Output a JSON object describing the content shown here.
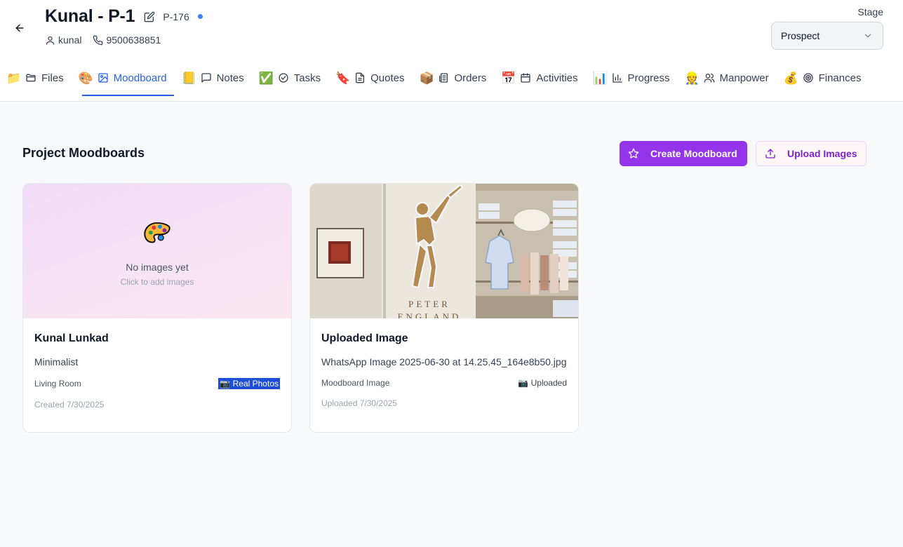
{
  "header": {
    "title": "Kunal - P-1",
    "code": "P-176",
    "user": "kunal",
    "phone": "9500638851",
    "stage_label": "Stage",
    "stage_value": "Prospect"
  },
  "tabs": [
    {
      "emoji": "📁",
      "label": "Files"
    },
    {
      "emoji": "🎨",
      "label": "Moodboard"
    },
    {
      "emoji": "📒",
      "label": "Notes"
    },
    {
      "emoji": "✅",
      "label": "Tasks"
    },
    {
      "emoji": "🔖",
      "label": "Quotes"
    },
    {
      "emoji": "📦",
      "label": "Orders"
    },
    {
      "emoji": "📅",
      "label": "Activities"
    },
    {
      "emoji": "📊",
      "label": "Progress"
    },
    {
      "emoji": "👷",
      "label": "Manpower"
    },
    {
      "emoji": "💰",
      "label": "Finances"
    }
  ],
  "active_tab": "Moodboard",
  "section": {
    "title": "Project Moodboards",
    "create_label": "Create Moodboard",
    "upload_label": "Upload Images"
  },
  "cards": [
    {
      "empty_title": "No images yet",
      "empty_sub": "Click to add images",
      "title": "Kunal Lunkad",
      "description": "Minimalist",
      "room": "Living Room",
      "badge": "📷 Real Photos",
      "date": "Created 7/30/2025"
    },
    {
      "photo_text": "PETER ENGLAND",
      "title": "Uploaded Image",
      "description": "WhatsApp Image 2025-06-30 at 14.25.45_164e8b50.jpg",
      "room": "Moodboard Image",
      "badge": "📷 Uploaded",
      "date": "Uploaded 7/30/2025"
    }
  ],
  "colors": {
    "primary": "#9333ea",
    "active_tab": "#2563eb",
    "status_dot": "#3b82f6"
  }
}
